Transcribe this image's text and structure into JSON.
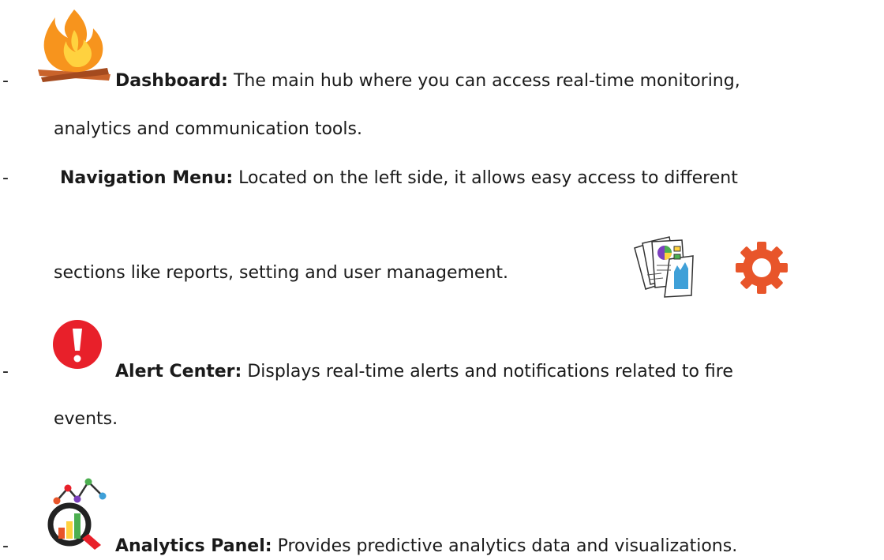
{
  "bullet_marker": "-",
  "items": [
    {
      "icon": "campfire-icon",
      "term": "Dashboard:",
      "text_line1": " The main hub where you can access real-time monitoring,",
      "text_line2": "analytics and communication tools."
    },
    {
      "icon": "",
      "term": "Navigation Menu:",
      "text_line1": " Located on the left side, it allows easy access to different",
      "text_line2": "sections like reports, setting and user management.",
      "trailing_icons": [
        "report-document-icon",
        "gear-icon"
      ]
    },
    {
      "icon": "exclamation-alert-icon",
      "term": "Alert Center:",
      "text_line1": " Displays real-time alerts and notifications related to fire",
      "text_line2": "events."
    },
    {
      "icon": "analytics-magnifier-icon",
      "term": "Analytics Panel:",
      "text_line1": " Provides predictive analytics data and visualizations."
    }
  ],
  "colors": {
    "text": "#1a1a1a",
    "alert_red": "#e8202a",
    "gear_orange": "#e8552a",
    "flame_orange": "#f7941d",
    "flame_yellow": "#ffd23f"
  }
}
